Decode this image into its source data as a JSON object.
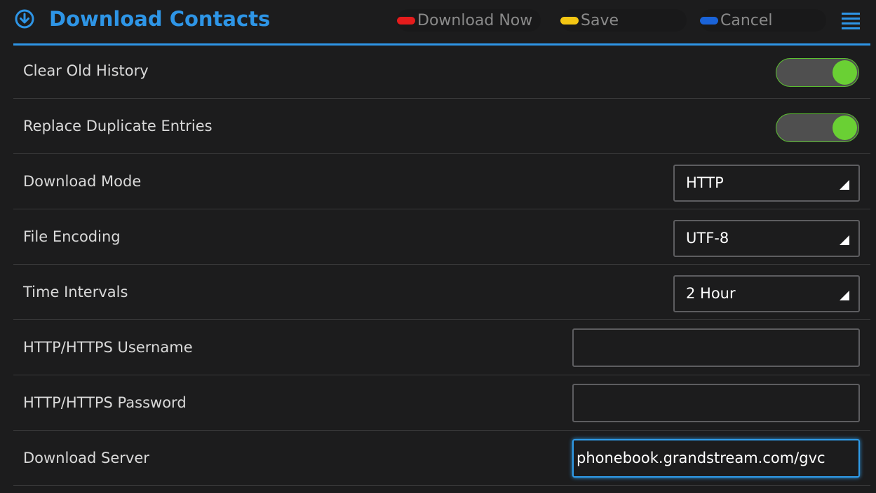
{
  "header": {
    "title": "Download Contacts",
    "icon": "download-circle-icon",
    "accent_color": "#2e95e6",
    "softkeys": [
      {
        "label": "Download Now",
        "color": "#e51c1c"
      },
      {
        "label": "Save",
        "color": "#f3c613"
      },
      {
        "label": "Cancel",
        "color": "#1a63d8"
      }
    ],
    "menu_icon": "menu-lines-icon"
  },
  "rows": {
    "clear_old_history": {
      "label": "Clear Old History",
      "enabled": true
    },
    "replace_duplicates": {
      "label": "Replace Duplicate Entries",
      "enabled": true
    },
    "download_mode": {
      "label": "Download Mode",
      "value": "HTTP"
    },
    "file_encoding": {
      "label": "File Encoding",
      "value": "UTF-8"
    },
    "time_intervals": {
      "label": "Time Intervals",
      "value": "2 Hour"
    },
    "username": {
      "label": "HTTP/HTTPS Username",
      "value": ""
    },
    "password": {
      "label": "HTTP/HTTPS Password",
      "value": ""
    },
    "download_server": {
      "label": "Download Server",
      "value": "phonebook.grandstream.com/gvc"
    }
  },
  "colors": {
    "toggle_on": "#6ad034",
    "focus": "#2f9be8"
  }
}
